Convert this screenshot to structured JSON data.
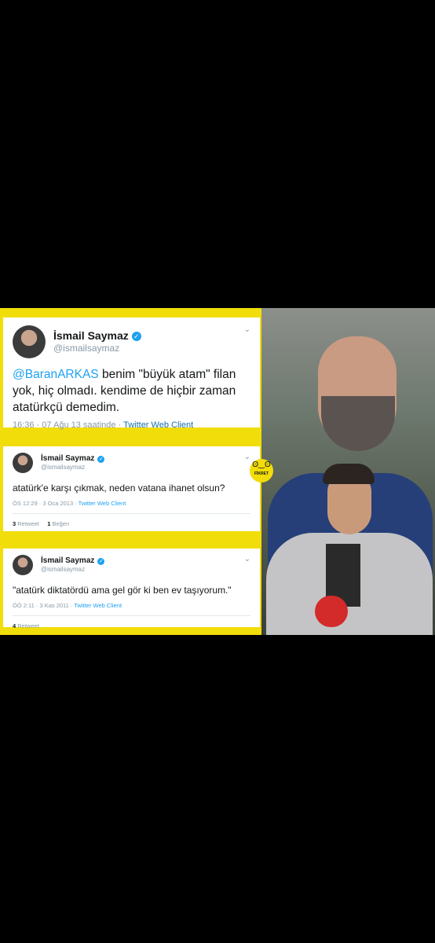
{
  "tweet1": {
    "name": "İsmail Saymaz",
    "handle": "@ismailsaymaz",
    "mention": "@BaranARKAS",
    "text": " benim \"büyük atam\" filan yok, hiç olmadı. kendime de hiçbir zaman atatürkçü demedim.",
    "time": "16:36 · 07 Ağu 13 saatinde · ",
    "client": "Twitter Web Client"
  },
  "tweet2": {
    "name": "İsmail Saymaz",
    "handle": "@ismailsaymaz",
    "text": "atatürk'e karşı çıkmak, neden vatana ihanet olsun?",
    "time": "ÖS 12:29 · 3 Oca 2013 · ",
    "client": "Twitter Web Client",
    "retweet_count": "3",
    "retweet_label": " Retweet",
    "like_count": "1",
    "like_label": " Beğen"
  },
  "tweet3": {
    "name": "İsmail Saymaz",
    "handle": "@ismailsaymaz",
    "text": "\"atatürk diktatördü ama gel gör ki ben ev taşıyorum.\"",
    "time": "ÖÖ 2:11 · 3 Kas 2011 · ",
    "client": "Twitter Web Client",
    "retweet_count": "4",
    "retweet_label": " Retweet"
  },
  "logo": {
    "text": "FİKRET",
    "glyph": "ʘ‿ʘ"
  },
  "icons": {
    "verified": "verified-badge-icon",
    "chevron": "chevron-down-icon"
  },
  "colors": {
    "background": "#000000",
    "frame": "#f1dd0a",
    "link": "#1da1f2"
  }
}
